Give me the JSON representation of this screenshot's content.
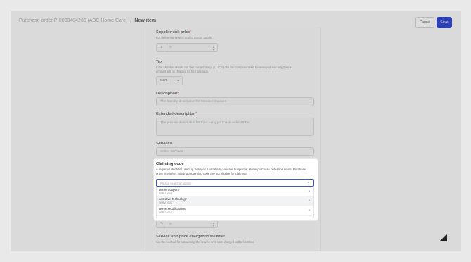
{
  "header": {
    "breadcrumb_prev": "Purchase order P-0000404235 (ABC Home Care)",
    "breadcrumb_sep": "/",
    "breadcrumb_current": "New item",
    "cancel_label": "Cancel",
    "save_label": "Save"
  },
  "fields": {
    "supplier_price": {
      "label": "Supplier unit price",
      "required": "*",
      "hint": "For delivering service and/or cost of goods.",
      "prefix": "$",
      "value": "0"
    },
    "tax": {
      "label": "Tax",
      "hint": "If the Member should not be charged tax (e.g. HCP), the tax component will be removed and only the net amount will be charged to their package.",
      "value": "GST"
    },
    "description": {
      "label": "Description",
      "required": "*",
      "placeholder": "The friendly description for Member invoices"
    },
    "extended_description": {
      "label": "Extended description",
      "required": "*",
      "placeholder": "The precise description for third-party purchase order PDFs"
    },
    "services": {
      "label": "Services",
      "placeholder": "Select services"
    },
    "unit_price_member": {
      "prefix": "%",
      "value": "0"
    },
    "service_unit_price": {
      "label": "Service unit price charged to Member",
      "hint": "Set the method for calculating the service unit price charged to the Member."
    }
  },
  "claiming_popup": {
    "title": "Claiming code",
    "description": "A required identifier used by Services Australia to validate Support at Home purchase order line items. Purchase order line items missing a claiming code are not eligible for claiming.",
    "placeholder": "Please select an option",
    "options": [
      {
        "name": "Home Support",
        "code": "SERV-0001"
      },
      {
        "name": "Assistive Technology",
        "code": "SERV-0002"
      },
      {
        "name": "Home Modifications",
        "code": "SERV-0003"
      }
    ]
  },
  "colors": {
    "primary": "#2b3fb5",
    "focus": "#3a57c7"
  }
}
